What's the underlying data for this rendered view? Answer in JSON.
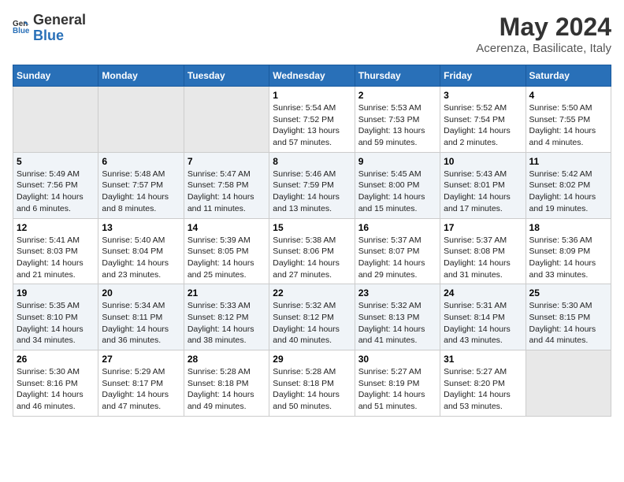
{
  "header": {
    "logo_general": "General",
    "logo_blue": "Blue",
    "month_year": "May 2024",
    "location": "Acerenza, Basilicate, Italy"
  },
  "days_of_week": [
    "Sunday",
    "Monday",
    "Tuesday",
    "Wednesday",
    "Thursday",
    "Friday",
    "Saturday"
  ],
  "weeks": [
    [
      {
        "day": "",
        "empty": true
      },
      {
        "day": "",
        "empty": true
      },
      {
        "day": "",
        "empty": true
      },
      {
        "day": "1",
        "sunrise": "5:54 AM",
        "sunset": "7:52 PM",
        "daylight": "13 hours and 57 minutes."
      },
      {
        "day": "2",
        "sunrise": "5:53 AM",
        "sunset": "7:53 PM",
        "daylight": "13 hours and 59 minutes."
      },
      {
        "day": "3",
        "sunrise": "5:52 AM",
        "sunset": "7:54 PM",
        "daylight": "14 hours and 2 minutes."
      },
      {
        "day": "4",
        "sunrise": "5:50 AM",
        "sunset": "7:55 PM",
        "daylight": "14 hours and 4 minutes."
      }
    ],
    [
      {
        "day": "5",
        "sunrise": "5:49 AM",
        "sunset": "7:56 PM",
        "daylight": "14 hours and 6 minutes."
      },
      {
        "day": "6",
        "sunrise": "5:48 AM",
        "sunset": "7:57 PM",
        "daylight": "14 hours and 8 minutes."
      },
      {
        "day": "7",
        "sunrise": "5:47 AM",
        "sunset": "7:58 PM",
        "daylight": "14 hours and 11 minutes."
      },
      {
        "day": "8",
        "sunrise": "5:46 AM",
        "sunset": "7:59 PM",
        "daylight": "14 hours and 13 minutes."
      },
      {
        "day": "9",
        "sunrise": "5:45 AM",
        "sunset": "8:00 PM",
        "daylight": "14 hours and 15 minutes."
      },
      {
        "day": "10",
        "sunrise": "5:43 AM",
        "sunset": "8:01 PM",
        "daylight": "14 hours and 17 minutes."
      },
      {
        "day": "11",
        "sunrise": "5:42 AM",
        "sunset": "8:02 PM",
        "daylight": "14 hours and 19 minutes."
      }
    ],
    [
      {
        "day": "12",
        "sunrise": "5:41 AM",
        "sunset": "8:03 PM",
        "daylight": "14 hours and 21 minutes."
      },
      {
        "day": "13",
        "sunrise": "5:40 AM",
        "sunset": "8:04 PM",
        "daylight": "14 hours and 23 minutes."
      },
      {
        "day": "14",
        "sunrise": "5:39 AM",
        "sunset": "8:05 PM",
        "daylight": "14 hours and 25 minutes."
      },
      {
        "day": "15",
        "sunrise": "5:38 AM",
        "sunset": "8:06 PM",
        "daylight": "14 hours and 27 minutes."
      },
      {
        "day": "16",
        "sunrise": "5:37 AM",
        "sunset": "8:07 PM",
        "daylight": "14 hours and 29 minutes."
      },
      {
        "day": "17",
        "sunrise": "5:37 AM",
        "sunset": "8:08 PM",
        "daylight": "14 hours and 31 minutes."
      },
      {
        "day": "18",
        "sunrise": "5:36 AM",
        "sunset": "8:09 PM",
        "daylight": "14 hours and 33 minutes."
      }
    ],
    [
      {
        "day": "19",
        "sunrise": "5:35 AM",
        "sunset": "8:10 PM",
        "daylight": "14 hours and 34 minutes."
      },
      {
        "day": "20",
        "sunrise": "5:34 AM",
        "sunset": "8:11 PM",
        "daylight": "14 hours and 36 minutes."
      },
      {
        "day": "21",
        "sunrise": "5:33 AM",
        "sunset": "8:12 PM",
        "daylight": "14 hours and 38 minutes."
      },
      {
        "day": "22",
        "sunrise": "5:32 AM",
        "sunset": "8:12 PM",
        "daylight": "14 hours and 40 minutes."
      },
      {
        "day": "23",
        "sunrise": "5:32 AM",
        "sunset": "8:13 PM",
        "daylight": "14 hours and 41 minutes."
      },
      {
        "day": "24",
        "sunrise": "5:31 AM",
        "sunset": "8:14 PM",
        "daylight": "14 hours and 43 minutes."
      },
      {
        "day": "25",
        "sunrise": "5:30 AM",
        "sunset": "8:15 PM",
        "daylight": "14 hours and 44 minutes."
      }
    ],
    [
      {
        "day": "26",
        "sunrise": "5:30 AM",
        "sunset": "8:16 PM",
        "daylight": "14 hours and 46 minutes."
      },
      {
        "day": "27",
        "sunrise": "5:29 AM",
        "sunset": "8:17 PM",
        "daylight": "14 hours and 47 minutes."
      },
      {
        "day": "28",
        "sunrise": "5:28 AM",
        "sunset": "8:18 PM",
        "daylight": "14 hours and 49 minutes."
      },
      {
        "day": "29",
        "sunrise": "5:28 AM",
        "sunset": "8:18 PM",
        "daylight": "14 hours and 50 minutes."
      },
      {
        "day": "30",
        "sunrise": "5:27 AM",
        "sunset": "8:19 PM",
        "daylight": "14 hours and 51 minutes."
      },
      {
        "day": "31",
        "sunrise": "5:27 AM",
        "sunset": "8:20 PM",
        "daylight": "14 hours and 53 minutes."
      },
      {
        "day": "",
        "empty": true
      }
    ]
  ],
  "labels": {
    "sunrise": "Sunrise:",
    "sunset": "Sunset:",
    "daylight": "Daylight:"
  }
}
